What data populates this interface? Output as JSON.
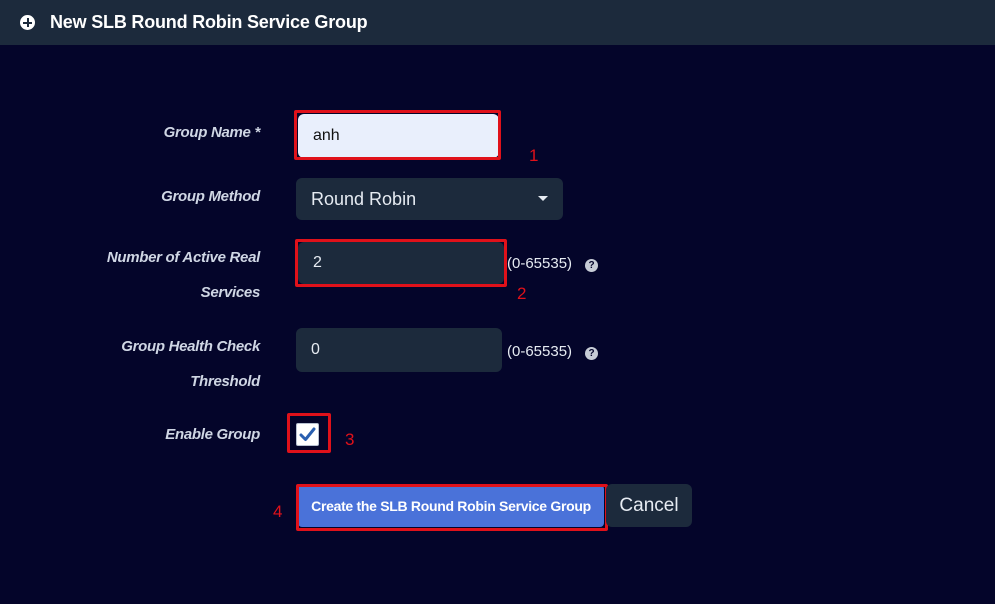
{
  "header": {
    "title": "New SLB Round Robin Service Group",
    "icon": "plus-circle-icon"
  },
  "form": {
    "group_name": {
      "label": "Group Name *",
      "value": "anh"
    },
    "group_method": {
      "label": "Group Method",
      "selected": "Round Robin"
    },
    "active_real_services": {
      "label_line1": "Number of Active Real",
      "label_line2": "Services",
      "value": "2",
      "range": "(0-65535)"
    },
    "health_check_threshold": {
      "label_line1": "Group Health Check",
      "label_line2": "Threshold",
      "value": "0",
      "range": "(0-65535)"
    },
    "enable_group": {
      "label": "Enable Group",
      "checked": true
    },
    "help_glyph": "?"
  },
  "actions": {
    "create_label": "Create the SLB Round Robin Service Group",
    "cancel_label": "Cancel"
  },
  "annotations": {
    "step1": "1",
    "step2": "2",
    "step3": "3",
    "step4": "4",
    "highlight_color": "#e0111a"
  },
  "colors": {
    "background": "#04052a",
    "header": "#1c2a3c",
    "field": "#1c2a3c",
    "field_light": "#e9effc",
    "primary_button": "#4a72d9"
  }
}
